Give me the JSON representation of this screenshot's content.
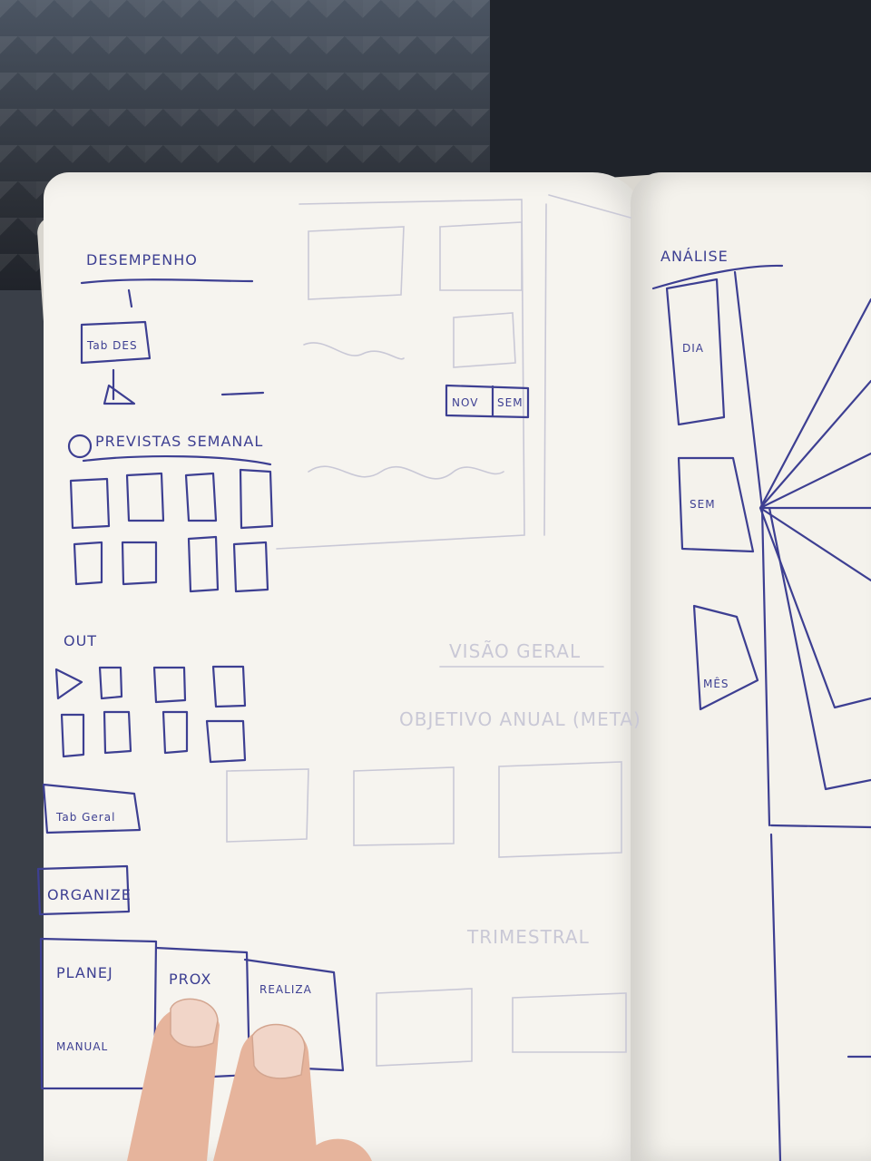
{
  "photo": {
    "subject": "hand-drawn UI wireframe sketch in a notebook",
    "ink_color": "#3d3f92",
    "paper_color": "#f6f4ef"
  },
  "left_page": {
    "title": "DESEMPENHO",
    "tab_label": "Tab DES",
    "section_semanal": "PREVISTAS SEMANAL",
    "section_out": "OUT",
    "tab_geral": "Tab Geral",
    "organize": "ORGANIZE",
    "cards": {
      "planejar_label": "PLANEJ",
      "manual_label": "MANUAL",
      "prox_label": "PROX",
      "realiza_label": "REALIZA"
    },
    "toggle": {
      "left": "NOV",
      "right": "SEM"
    }
  },
  "right_page": {
    "title": "ANÁLISE",
    "items": [
      "DIA",
      "SEM",
      "MÊS"
    ]
  },
  "show_through": {
    "visao_geral": "VISÃO GERAL",
    "objetivo": "OBJETIVO ANUAL (META)",
    "trimestral": "TRIMESTRAL"
  }
}
